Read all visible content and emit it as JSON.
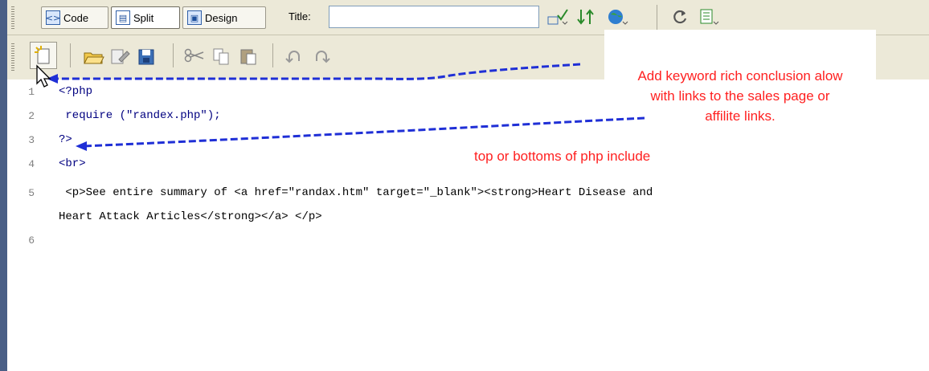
{
  "toolbar": {
    "code_label": "Code",
    "split_label": "Split",
    "design_label": "Design",
    "title_label": "Title:",
    "title_value": ""
  },
  "code_lines": [
    {
      "num": "1",
      "text": "<?php"
    },
    {
      "num": "2",
      "text": " require (\"randex.php\");"
    },
    {
      "num": "3",
      "text": "?>"
    },
    {
      "num": "4",
      "text": "<br>"
    },
    {
      "num": "5",
      "text": " <p>See entire summary of <a href=\"randax.htm\" target=\"_blank\"><strong>Heart Disease and"
    },
    {
      "num": "",
      "text": "Heart Attack Articles</strong></a> </p>"
    },
    {
      "num": "6",
      "text": ""
    }
  ],
  "annotations": {
    "note1_line1": "Add keyword rich conclusion alow",
    "note1_line2": "with links to the sales page or",
    "note1_line3": "affilite links.",
    "note2": "top or bottoms of php include"
  },
  "colors": {
    "annotation_text": "#ff2020",
    "arrow": "#1f2fd6",
    "left_bar": "#4a5f86"
  }
}
